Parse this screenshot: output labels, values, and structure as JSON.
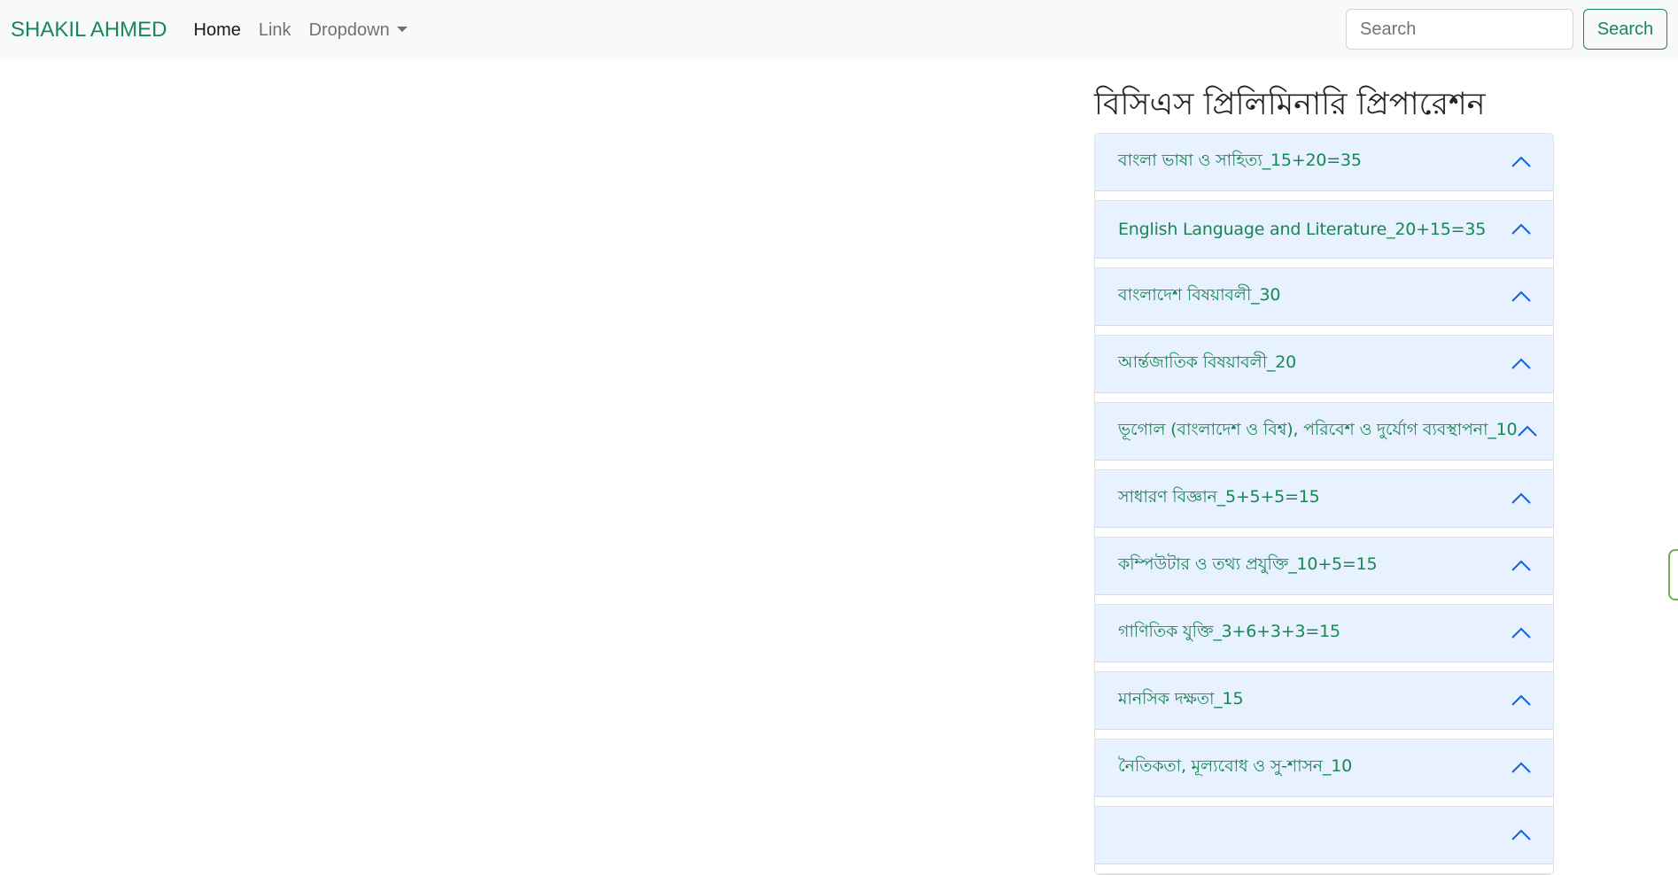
{
  "navbar": {
    "brand": "SHAKIL AHMED",
    "links": [
      {
        "label": "Home",
        "active": true
      },
      {
        "label": "Link",
        "active": false
      }
    ],
    "dropdown_label": "Dropdown",
    "search_placeholder": "Search",
    "search_button": "Search"
  },
  "main": {
    "title": "বিসিএস প্রিলিমিনারি প্রিপারেশন",
    "accordion": [
      {
        "label": "বাংলা ভাষা ও সাহিত্য_15+20=35"
      },
      {
        "label": "English Language and Literature_20+15=35"
      },
      {
        "label": "বাংলাদেশ বিষয়াবলী_30"
      },
      {
        "label": "আর্ন্তজাতিক বিষয়াবলী_20"
      },
      {
        "label": "ভূগোল (বাংলাদেশ ও বিশ্ব), পরিবেশ ও দুর্যোগ ব্যবস্থাপনা_10"
      },
      {
        "label": "সাধারণ বিজ্ঞান_5+5+5=15"
      },
      {
        "label": "কম্পিউটার ও তথ্য প্রযুক্তি_10+5=15"
      },
      {
        "label": "গাণিতিক যুক্তি_3+6+3+3=15"
      },
      {
        "label": "মানসিক দক্ষতা_15"
      },
      {
        "label": "নৈতিকতা, মূল্যবোধ ও সু-শাসন_10"
      },
      {
        "label": ""
      }
    ]
  },
  "colors": {
    "brand": "#198754",
    "accordion_bg": "#e7f1ff",
    "chevron": "#0c63e4"
  }
}
